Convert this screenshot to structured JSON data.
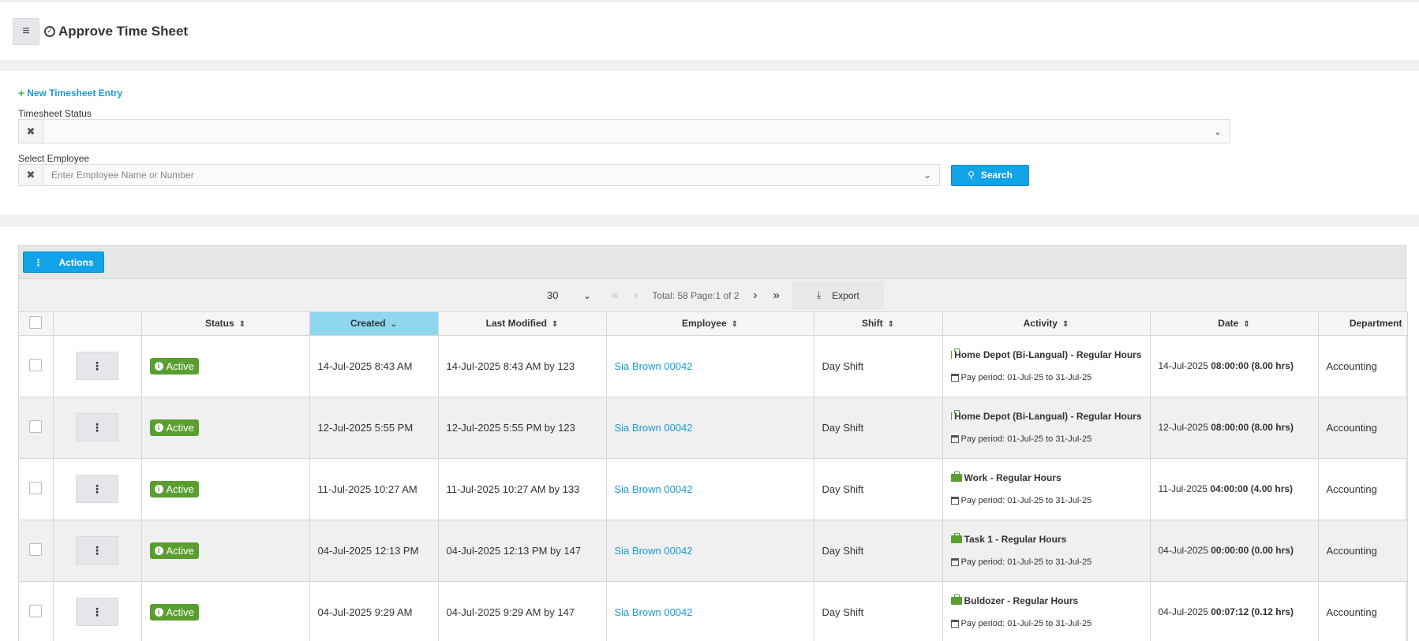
{
  "header": {
    "title": "Approve Time Sheet"
  },
  "filters": {
    "new_entry_label": "New Timesheet Entry",
    "timesheet_status_label": "Timesheet Status",
    "timesheet_status_value": "",
    "employee_label": "Select Employee",
    "employee_placeholder": "Enter Employee Name or Number",
    "search_label": "Search"
  },
  "toolbar": {
    "actions_label": "Actions"
  },
  "pager": {
    "page_size": "30",
    "total_text": "Total: 58 Page:1 of 2",
    "export_label": "Export"
  },
  "columns": {
    "status": "Status",
    "created": "Created",
    "last_modified": "Last Modified",
    "employee": "Employee",
    "shift": "Shift",
    "activity": "Activity",
    "date": "Date",
    "department": "Department"
  },
  "rows": [
    {
      "status": "Active",
      "created": "14-Jul-2025 8:43 AM",
      "last_modified": "14-Jul-2025 8:43 AM by 123",
      "employee": "Sia Brown 00042",
      "shift": "Day Shift",
      "activity": "Home Depot (Bi-Langual) - Regular Hours",
      "pay_period": "Pay period: 01-Jul-25 to 31-Jul-25",
      "date": "14-Jul-2025",
      "duration": "08:00:00 (8.00 hrs)",
      "department": "Accounting"
    },
    {
      "status": "Active",
      "created": "12-Jul-2025 5:55 PM",
      "last_modified": "12-Jul-2025 5:55 PM by 123",
      "employee": "Sia Brown 00042",
      "shift": "Day Shift",
      "activity": "Home Depot (Bi-Langual) - Regular Hours",
      "pay_period": "Pay period: 01-Jul-25 to 31-Jul-25",
      "date": "12-Jul-2025",
      "duration": "08:00:00 (8.00 hrs)",
      "department": "Accounting"
    },
    {
      "status": "Active",
      "created": "11-Jul-2025 10:27 AM",
      "last_modified": "11-Jul-2025 10:27 AM by 133",
      "employee": "Sia Brown 00042",
      "shift": "Day Shift",
      "activity": "Work - Regular Hours",
      "pay_period": "Pay period: 01-Jul-25 to 31-Jul-25",
      "date": "11-Jul-2025",
      "duration": "04:00:00 (4.00 hrs)",
      "department": "Accounting"
    },
    {
      "status": "Active",
      "created": "04-Jul-2025 12:13 PM",
      "last_modified": "04-Jul-2025 12:13 PM by 147",
      "employee": "Sia Brown 00042",
      "shift": "Day Shift",
      "activity": "Task 1 - Regular Hours",
      "pay_period": "Pay period: 01-Jul-25 to 31-Jul-25",
      "date": "04-Jul-2025",
      "duration": "00:00:00 (0.00 hrs)",
      "department": "Accounting"
    },
    {
      "status": "Active",
      "created": "04-Jul-2025 9:29 AM",
      "last_modified": "04-Jul-2025 9:29 AM by 147",
      "employee": "Sia Brown 00042",
      "shift": "Day Shift",
      "activity": "Buldozer - Regular Hours",
      "pay_period": "Pay period: 01-Jul-25 to 31-Jul-25",
      "date": "04-Jul-2025",
      "duration": "00:07:12 (0.12 hrs)",
      "department": "Accounting"
    }
  ]
}
